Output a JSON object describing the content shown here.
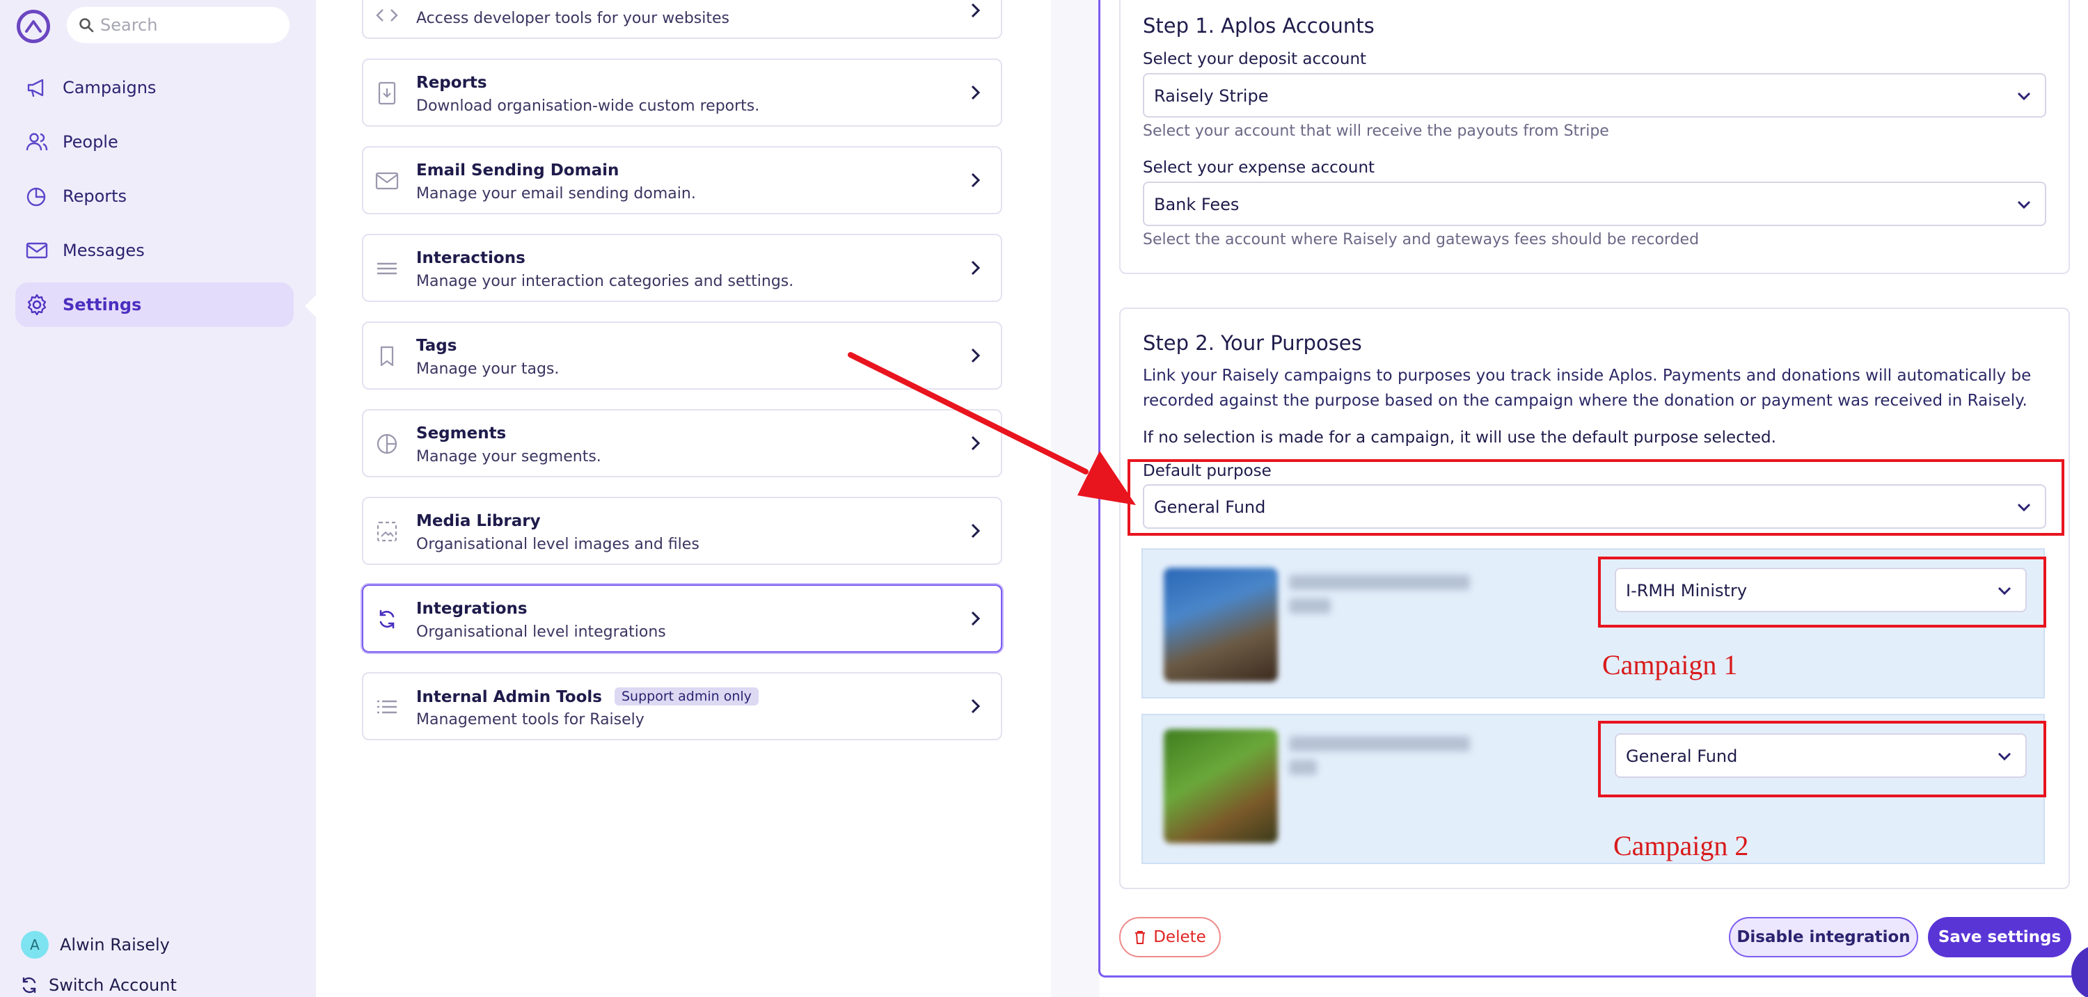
{
  "sidebar": {
    "search_placeholder": "Search",
    "items": [
      {
        "label": "Campaigns",
        "icon": "megaphone-icon"
      },
      {
        "label": "People",
        "icon": "people-icon"
      },
      {
        "label": "Reports",
        "icon": "pie-chart-icon"
      },
      {
        "label": "Messages",
        "icon": "envelope-icon"
      },
      {
        "label": "Settings",
        "icon": "gear-icon",
        "active": true
      }
    ],
    "user": {
      "initial": "A",
      "name": "Alwin Raisely"
    },
    "switch_account": "Switch Account"
  },
  "settings_cards": [
    {
      "title": "",
      "desc": "Access developer tools for your websites",
      "icon": "code-icon"
    },
    {
      "title": "Reports",
      "desc": "Download organisation-wide custom reports.",
      "icon": "report-download-icon"
    },
    {
      "title": "Email Sending Domain",
      "desc": "Manage your email sending domain.",
      "icon": "envelope-icon"
    },
    {
      "title": "Interactions",
      "desc": "Manage your interaction categories and settings.",
      "icon": "lines-icon"
    },
    {
      "title": "Tags",
      "desc": "Manage your tags.",
      "icon": "tag-icon"
    },
    {
      "title": "Segments",
      "desc": "Manage your segments.",
      "icon": "segment-icon"
    },
    {
      "title": "Media Library",
      "desc": "Organisational level images and files",
      "icon": "image-icon"
    },
    {
      "title": "Integrations",
      "desc": "Organisational level integrations",
      "icon": "sync-icon",
      "selected": true
    },
    {
      "title": "Internal Admin Tools",
      "badge": "Support admin only",
      "desc": "Management tools for Raisely",
      "icon": "list-icon"
    }
  ],
  "step1": {
    "title": "Step 1. Aplos Accounts",
    "deposit_label": "Select your deposit account",
    "deposit_value": "Raisely Stripe",
    "deposit_help": "Select your account that will receive the payouts from Stripe",
    "expense_label": "Select your expense account",
    "expense_value": "Bank Fees",
    "expense_help": "Select the account where Raisely and gateways fees should be recorded"
  },
  "step2": {
    "title": "Step 2. Your Purposes",
    "description_line1": "Link your Raisely campaigns to purposes you track inside Aplos. Payments and donations will automatically be",
    "description_line2": "recorded against the purpose based on the campaign where the donation or payment was received in Raisely.",
    "note": "If no selection is made for a campaign, it will use the default purpose selected.",
    "default_label": "Default purpose",
    "default_value": "General Fund",
    "campaigns": [
      {
        "purpose": "I-RMH Ministry",
        "annotation": "Campaign 1"
      },
      {
        "purpose": "General Fund",
        "annotation": "Campaign 2"
      }
    ]
  },
  "actions": {
    "delete": "Delete",
    "disable": "Disable integration",
    "save": "Save settings"
  },
  "colors": {
    "accent": "#5a35d6",
    "sidebar_bg": "#f0edfb",
    "annotation_red": "#e8141e",
    "campaign_row_bg": "#e3eefb"
  }
}
